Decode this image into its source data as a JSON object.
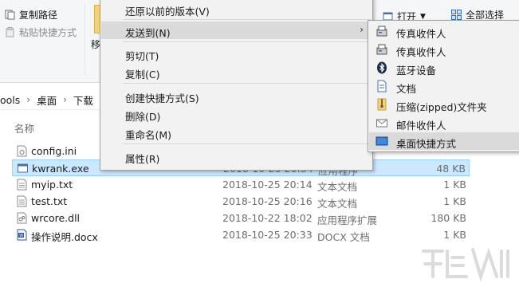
{
  "ribbon": {
    "copy_path": "复制路径",
    "paste_shortcut": "粘贴快捷方式",
    "move_partial": "移",
    "open": "打开",
    "select_all": "全部选择"
  },
  "breadcrumb": [
    "ools",
    "桌面",
    "下载"
  ],
  "file_list": {
    "header_name": "名称",
    "rows": [
      {
        "name": "config.ini",
        "date": "",
        "type": "",
        "size": ""
      },
      {
        "name": "kwrank.exe",
        "date": "2018-10-25 20:34",
        "type": "应用程序",
        "size": "48 KB"
      },
      {
        "name": "myip.txt",
        "date": "2018-10-25 20:14",
        "type": "文本文档",
        "size": "1 KB"
      },
      {
        "name": "test.txt",
        "date": "2018-10-25 20:16",
        "type": "文本文档",
        "size": "1 KB"
      },
      {
        "name": "wrcore.dll",
        "date": "2018-10-22 18:02",
        "type": "应用程序扩展",
        "size": "180 KB"
      },
      {
        "name": "操作说明.docx",
        "date": "2018-10-25 20:33",
        "type": "DOCX 文档",
        "size": "1 KB"
      }
    ]
  },
  "context_menu": {
    "restore": "还原以前的版本(V)",
    "send_to": "发送到(N)",
    "cut": "剪切(T)",
    "copy": "复制(C)",
    "create_shortcut": "创建快捷方式(S)",
    "delete": "删除(D)",
    "rename": "重命名(M)",
    "properties": "属性(R)"
  },
  "send_to_menu": {
    "items": [
      "传真收件人",
      "传真收件人",
      "蓝牙设备",
      "文档",
      "压缩(zipped)文件夹",
      "邮件收件人",
      "桌面快捷方式"
    ]
  },
  "colors": {
    "selection_bg": "#cce8ff",
    "menu_bg": "#f2f2f2",
    "menu_hover": "#dadada"
  }
}
